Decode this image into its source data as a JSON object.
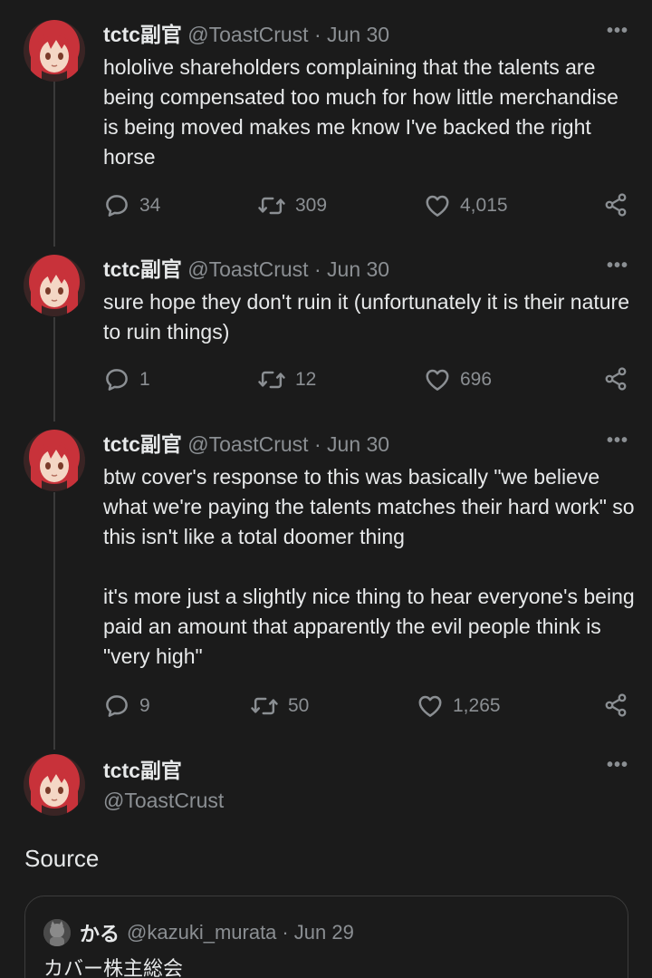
{
  "tweets": [
    {
      "name": "tctc副官",
      "handle": "@ToastCrust",
      "dot": "·",
      "date": "Jun 30",
      "more": "•••",
      "paragraphs": [
        "hololive shareholders complaining that the talents are being compensated too much for how little merchandise is being moved makes me know I've backed the right horse"
      ],
      "replies": "34",
      "retweets": "309",
      "likes": "4,015"
    },
    {
      "name": "tctc副官",
      "handle": "@ToastCrust",
      "dot": "·",
      "date": "Jun 30",
      "more": "•••",
      "paragraphs": [
        "sure hope they don't ruin it (unfortunately it is their nature to ruin things)"
      ],
      "replies": "1",
      "retweets": "12",
      "likes": "696"
    },
    {
      "name": "tctc副官",
      "handle": "@ToastCrust",
      "dot": "·",
      "date": "Jun 30",
      "more": "•••",
      "paragraphs": [
        "btw cover's response to this was basically \"we believe what we're paying the talents matches their hard work\" so this isn't like a total doomer thing",
        "it's more just a slightly nice thing to hear everyone's being paid an amount that apparently the evil people think is \"very high\""
      ],
      "replies": "9",
      "retweets": "50",
      "likes": "1,265"
    }
  ],
  "main_tweet": {
    "name": "tctc副官",
    "handle": "@ToastCrust",
    "more": "•••",
    "text": "Source"
  },
  "quote": {
    "name": "かる",
    "handle": "@kazuki_murata",
    "dot": "·",
    "date": "Jun 29",
    "text": "カバー株主総会"
  },
  "icons": {
    "reply": "reply-icon",
    "retweet": "retweet-icon",
    "like": "heart-icon",
    "share": "share-icon",
    "more": "more-options-icon"
  },
  "colors": {
    "background": "#1b1b1b",
    "text": "#e7e9ea",
    "muted": "#8b8f93",
    "avatar_hair": "#c8323a"
  }
}
